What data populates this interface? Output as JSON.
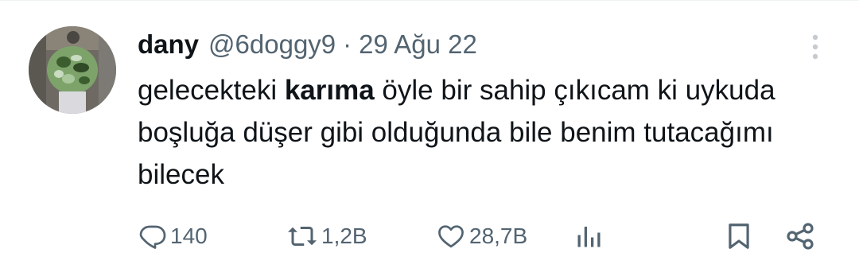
{
  "tweet": {
    "display_name": "dany",
    "handle": "@6doggy9",
    "separator": "·",
    "date": "29 Ağu 22",
    "text_before": "gelecekteki ",
    "text_bold": "karıma",
    "text_after": " öyle bir sahip çıkıcam ki uykuda boşluğa düşer gibi olduğunda bile benim tutacağımı bilecek"
  },
  "actions": {
    "replies": "140",
    "retweets": "1,2B",
    "likes": "28,7B"
  },
  "icons": {
    "more": "more-vertical-icon",
    "reply": "reply-icon",
    "retweet": "retweet-icon",
    "like": "heart-icon",
    "views": "views-icon",
    "bookmark": "bookmark-icon",
    "share": "share-icon"
  },
  "colors": {
    "text_primary": "#0f1419",
    "text_secondary": "#536471",
    "divider": "#eff3f4"
  }
}
